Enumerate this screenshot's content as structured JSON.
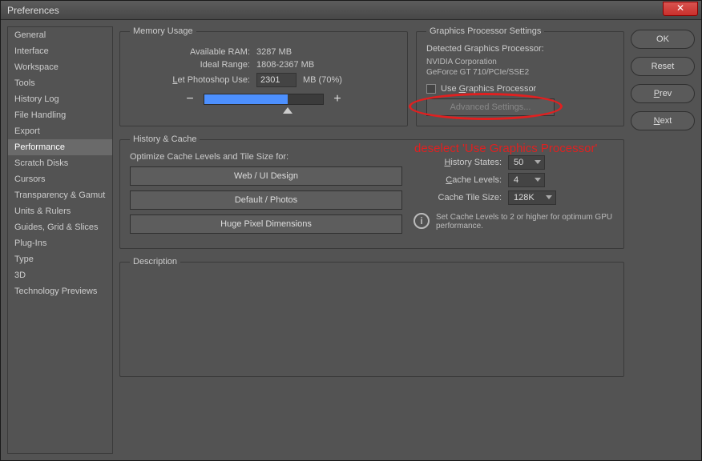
{
  "window": {
    "title": "Preferences"
  },
  "sidebar": {
    "items": [
      "General",
      "Interface",
      "Workspace",
      "Tools",
      "History Log",
      "File Handling",
      "Export",
      "Performance",
      "Scratch Disks",
      "Cursors",
      "Transparency & Gamut",
      "Units & Rulers",
      "Guides, Grid & Slices",
      "Plug-Ins",
      "Type",
      "3D",
      "Technology Previews"
    ],
    "selected_index": 7
  },
  "buttons": {
    "ok": "OK",
    "reset": "Reset",
    "prev": "Prev",
    "next": "Next"
  },
  "memory": {
    "legend": "Memory Usage",
    "available_label": "Available RAM:",
    "available_value": "3287 MB",
    "ideal_label": "Ideal Range:",
    "ideal_value": "1808-2367 MB",
    "use_label": "Let Photoshop Use:",
    "use_value": "2301",
    "use_suffix": "MB (70%)"
  },
  "gpu": {
    "legend": "Graphics Processor Settings",
    "detected_label": "Detected Graphics Processor:",
    "vendor": "NVIDIA Corporation",
    "model": "GeForce GT 710/PCIe/SSE2",
    "checkbox_label": "Use Graphics Processor",
    "checkbox_checked": false,
    "advanced": "Advanced Settings..."
  },
  "history": {
    "legend": "History & Cache",
    "optimize_label": "Optimize Cache Levels and Tile Size for:",
    "btn_web": "Web / UI Design",
    "btn_default": "Default / Photos",
    "btn_huge": "Huge Pixel Dimensions",
    "states_label": "History States:",
    "states_value": "50",
    "cache_label": "Cache Levels:",
    "cache_value": "4",
    "tile_label": "Cache Tile Size:",
    "tile_value": "128K",
    "info": "Set Cache Levels to 2 or higher for optimum GPU performance."
  },
  "description": {
    "legend": "Description"
  },
  "annotation": {
    "text": "deselect 'Use Graphics Processor'"
  }
}
